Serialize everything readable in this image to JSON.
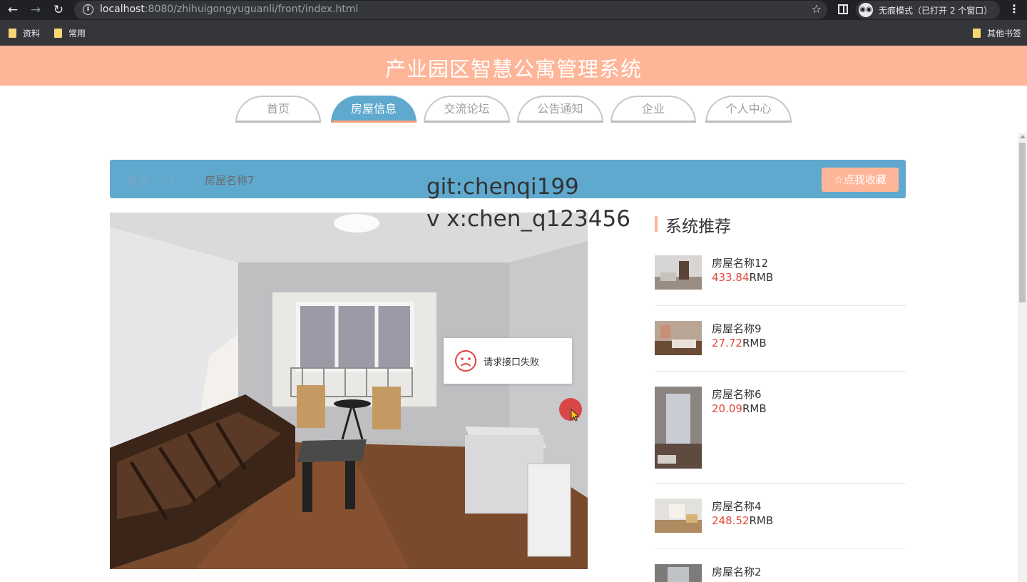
{
  "browser": {
    "url_host": "localhost",
    "url_rest": ":8080/zhihuigongyuguanli/front/index.html",
    "incognito_label": "无痕模式（已打开 2 个窗口）",
    "bookmarks": [
      "资料",
      "常用",
      "其他书签"
    ]
  },
  "site": {
    "title": "产业园区智慧公寓管理系统",
    "nav": [
      "首页",
      "房屋信息",
      "交流论坛",
      "公告通知",
      "企业",
      "个人中心"
    ],
    "active_nav": "房屋信息"
  },
  "breadcrumb": {
    "home": "首页",
    "separator": "/",
    "current": "房屋名称7"
  },
  "favorite_button": "☆点我收藏",
  "watermark": {
    "line1": "git:chenqi199",
    "line2": "v x:chen_q123456"
  },
  "toast": {
    "message": "请求接口失败",
    "icon": "sad-face-icon"
  },
  "recommend": {
    "title": "系统推荐",
    "items": [
      {
        "name": "房屋名称12",
        "price": "433.84",
        "unit": "RMB"
      },
      {
        "name": "房屋名称9",
        "price": "27.72",
        "unit": "RMB"
      },
      {
        "name": "房屋名称6",
        "price": "20.09",
        "unit": "RMB"
      },
      {
        "name": "房屋名称4",
        "price": "248.52",
        "unit": "RMB"
      },
      {
        "name": "房屋名称2",
        "price": "",
        "unit": ""
      }
    ]
  },
  "colors": {
    "header": "#ffb598",
    "accent_blue": "#5fa9cf",
    "price_red": "#e04a3a"
  }
}
